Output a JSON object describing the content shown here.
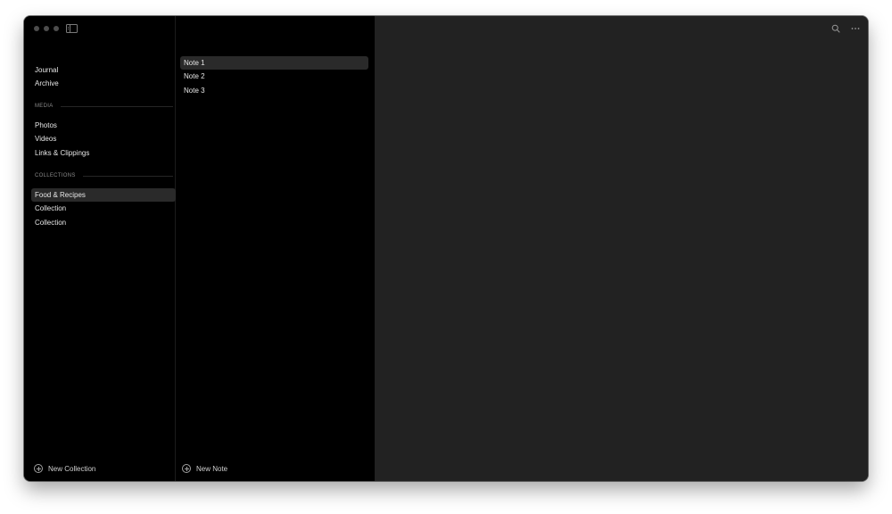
{
  "sidebar": {
    "primary": [
      {
        "label": "Journal"
      },
      {
        "label": "Archive"
      }
    ],
    "media_header": "MEDIA",
    "media": [
      {
        "label": "Photos"
      },
      {
        "label": "Videos"
      },
      {
        "label": "Links & Clippings"
      }
    ],
    "collections_header": "COLLECTIONS",
    "collections": [
      {
        "label": "Food & Recipes",
        "selected": true
      },
      {
        "label": "Collection"
      },
      {
        "label": "Collection"
      }
    ],
    "new_collection_label": "New Collection"
  },
  "notes": {
    "items": [
      {
        "label": "Note 1",
        "selected": true
      },
      {
        "label": "Note 2"
      },
      {
        "label": "Note 3"
      }
    ],
    "new_note_label": "New Note"
  },
  "toolbar": {
    "icons": [
      "search-icon",
      "more-icon"
    ]
  },
  "colors": {
    "sidebar_bg": "#000000",
    "editor_bg": "#222222",
    "selection_bg": "#2a2a2a",
    "text": "#e6e6e6"
  }
}
